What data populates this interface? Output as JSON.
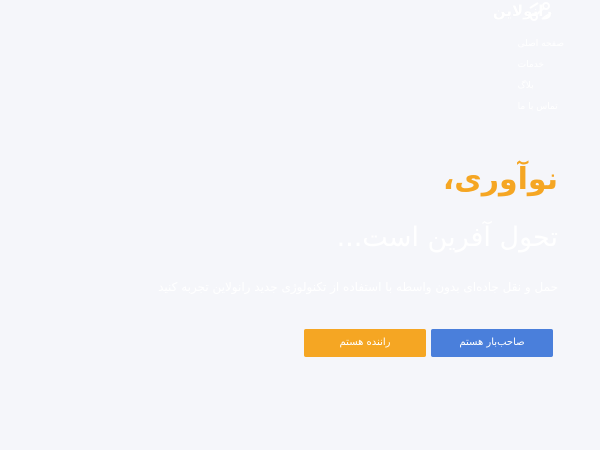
{
  "brand": {
    "name": "رانولاین",
    "accent_color": "#f5a623",
    "primary_color": "#4a7fdb",
    "logo_icon": "truck-logo-icon"
  },
  "nav": {
    "items": [
      {
        "label": "صفحه اصلی"
      },
      {
        "label": "خدمات"
      },
      {
        "label": "بلاگ"
      },
      {
        "label": "تماس با ما"
      }
    ]
  },
  "hero": {
    "title": "نوآوری،",
    "subtitle": "تحول آفرین است...",
    "description": "حمل و نقل جاده‌ای بدون واسطه با استفاده از تکنولوژی جدید رانولاین تجربه کنید"
  },
  "actions": {
    "owner_label": "صاحب‌بار هستم",
    "driver_label": "راننده هستم"
  }
}
